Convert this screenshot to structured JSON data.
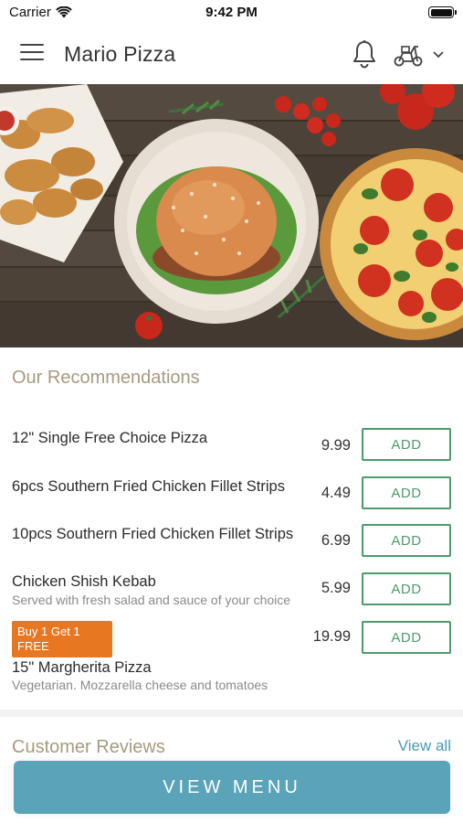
{
  "status_bar": {
    "carrier": "Carrier",
    "time": "9:42 PM"
  },
  "header": {
    "title": "Mario Pizza",
    "icons": [
      "hamburger-menu-icon",
      "bell-icon",
      "delivery-scooter-icon",
      "chevron-down-icon"
    ]
  },
  "hero": {
    "icon": "food-banner-image"
  },
  "recommendations": {
    "title": "Our Recommendations",
    "items": [
      {
        "name": "12\" Single Free Choice Pizza",
        "description": "",
        "price": "9.99",
        "button": "ADD",
        "badge": ""
      },
      {
        "name": "6pcs Southern Fried Chicken Fillet Strips",
        "description": "",
        "price": "4.49",
        "button": "ADD",
        "badge": ""
      },
      {
        "name": "10pcs Southern Fried Chicken Fillet Strips",
        "description": "",
        "price": "6.99",
        "button": "ADD",
        "badge": ""
      },
      {
        "name": "Chicken Shish Kebab",
        "description": "Served with fresh salad and sauce of your choice",
        "price": "5.99",
        "button": "ADD",
        "badge": ""
      },
      {
        "name": "15\" Margherita Pizza",
        "description": "Vegetarian. Mozzarella cheese and tomatoes",
        "price": "19.99",
        "button": "ADD",
        "badge": "Buy 1 Get 1 FREE"
      }
    ]
  },
  "reviews": {
    "title": "Customer Reviews",
    "link": "View all"
  },
  "footer": {
    "button": "VIEW MENU"
  },
  "colors": {
    "accent_green": "#4e9a6a",
    "section_title": "#a89a80",
    "badge_orange": "#e87722",
    "view_menu_button": "#5aa3b8",
    "link_blue": "#4a9ab5"
  }
}
